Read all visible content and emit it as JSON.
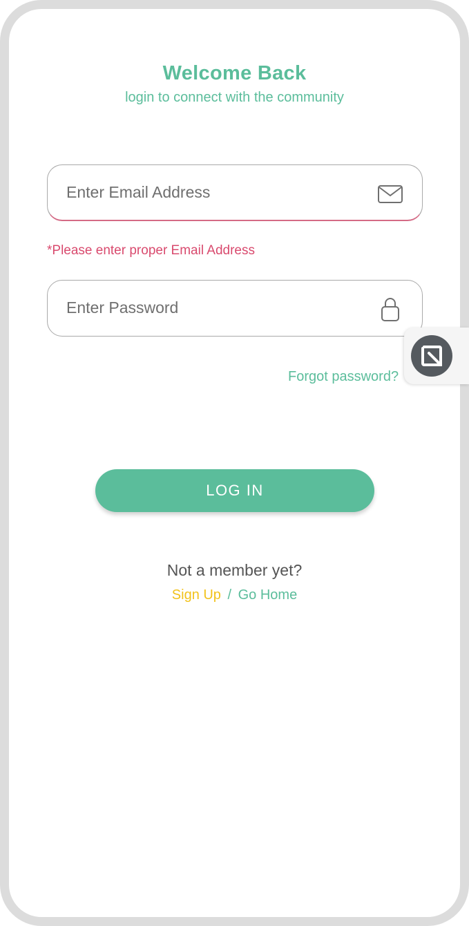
{
  "header": {
    "title": "Welcome Back",
    "subtitle": "login to connect with the community"
  },
  "form": {
    "email": {
      "placeholder": "Enter Email Address",
      "value": "",
      "icon": "envelope-icon",
      "error": "*Please enter proper Email Address"
    },
    "password": {
      "placeholder": "Enter Password",
      "value": "",
      "icon": "lock-icon"
    },
    "forgot_label": "Forgot password?",
    "login_label": "LOG IN"
  },
  "footer": {
    "prompt": "Not a member yet?",
    "signup_label": "Sign Up",
    "separator": "/",
    "gohome_label": "Go Home"
  },
  "floating_button": {
    "icon": "app-launcher-icon"
  },
  "colors": {
    "accent": "#5bbd9b",
    "error": "#d94a6e",
    "signup": "#f2c21b",
    "frame": "#dcdcdc"
  }
}
